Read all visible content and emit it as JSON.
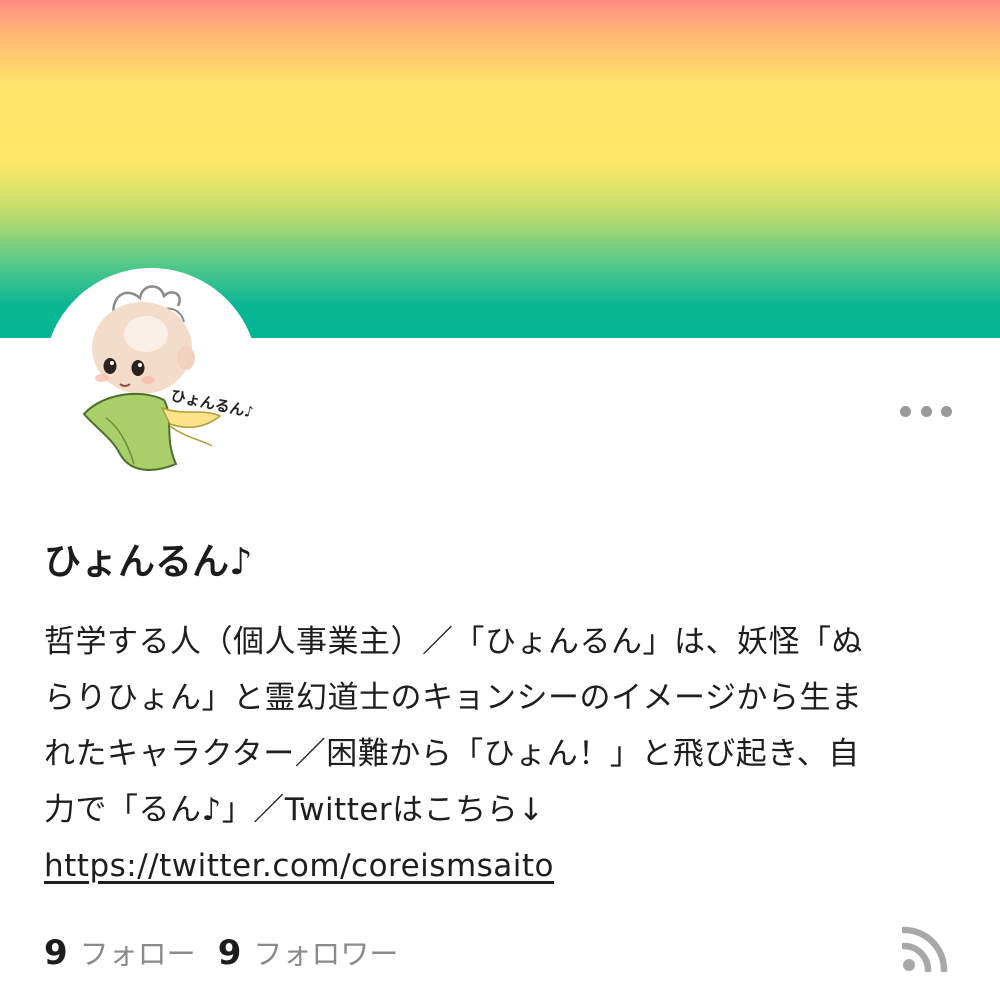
{
  "profile": {
    "name": "ひょんるん♪",
    "avatar_signature": "ひょんるん♪",
    "bio_lines": [
      "哲学する人（個人事業主）／「ひょんるん」は、妖怪「ぬ",
      "らりひょん」と霊幻道士のキョンシーのイメージから生ま",
      "れたキャラクター／困難から「ひょん！」と飛び起き、自",
      "力で「るん♪」／Twitterはこちら↓"
    ],
    "link": "https://twitter.com/coreismsaito"
  },
  "stats": {
    "follow_count": "9",
    "follow_label": "フォロー",
    "follower_count": "9",
    "follower_label": "フォロワー"
  },
  "icons": {
    "more": "more-horizontal-icon",
    "rss": "rss-icon"
  },
  "colors": {
    "cover_top": "#ff8a84",
    "cover_middle": "#ffe868",
    "cover_bottom": "#00b593",
    "accent_muted": "#9a9a9a"
  }
}
